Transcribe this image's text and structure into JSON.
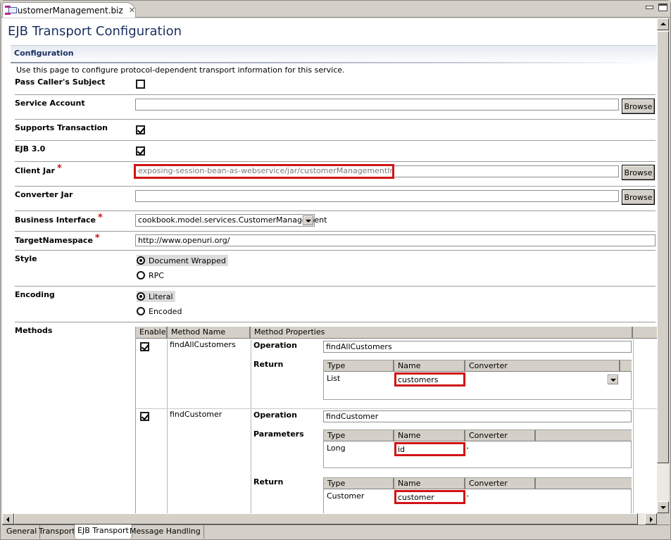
{
  "editor_tab": {
    "title": "CustomerManagement.biz",
    "icon": "biz-file-icon",
    "close_icon": "close-icon"
  },
  "window_controls": {
    "minimize_icon": "minimize-icon",
    "maximize_icon": "maximize-icon"
  },
  "page_title": "EJB Transport Configuration",
  "section": {
    "title": "Configuration",
    "description": "Use this page to configure protocol-dependent transport information for this service."
  },
  "fields": {
    "pass_callers_subject": {
      "label": "Pass Caller's Subject",
      "checked": false
    },
    "service_account": {
      "label": "Service Account",
      "value": "",
      "browse_label": "Browse"
    },
    "supports_transaction": {
      "label": "Supports Transaction",
      "checked": true
    },
    "ejb_30": {
      "label": "EJB 3.0",
      "checked": true
    },
    "client_jar": {
      "label": "Client Jar",
      "required": "*",
      "value": "exposing-session-bean-as-webservice/jar/customerManagementInterface",
      "browse_label": "Browse"
    },
    "converter_jar": {
      "label": "Converter Jar",
      "value": "",
      "browse_label": "Browse"
    },
    "business_interface": {
      "label": "Business Interface",
      "required": "*",
      "selected": "cookbook.model.services.CustomerManagement"
    },
    "target_namespace": {
      "label": "TargetNamespace",
      "required": "*",
      "value": "http://www.openuri.org/"
    },
    "style": {
      "label": "Style",
      "options": [
        "Document Wrapped",
        "RPC"
      ],
      "selected": "Document Wrapped"
    },
    "encoding": {
      "label": "Encoding",
      "options": [
        "Literal",
        "Encoded"
      ],
      "selected": "Literal"
    }
  },
  "methods": {
    "label": "Methods",
    "columns": [
      "Enable",
      "Method Name",
      "Method Properties"
    ],
    "operation_label": "Operation",
    "parameters_label": "Parameters",
    "return_label": "Return",
    "sub_columns": [
      "Type",
      "Name",
      "Converter"
    ],
    "rows": [
      {
        "enabled": true,
        "name": "findAllCustomers",
        "operation": "findAllCustomers",
        "return": {
          "type": "List",
          "name": "customers",
          "converter": ""
        }
      },
      {
        "enabled": true,
        "name": "findCustomer",
        "operation": "findCustomer",
        "parameters": [
          {
            "type": "Long",
            "name": "id",
            "converter": "-"
          }
        ],
        "return": {
          "type": "Customer",
          "name": "customer",
          "converter": "-"
        }
      }
    ]
  },
  "page_tabs": [
    {
      "label": "General",
      "active": false
    },
    {
      "label": "Transport",
      "active": false
    },
    {
      "label": "EJB Transport",
      "active": true
    },
    {
      "label": "Message Handling",
      "active": false
    }
  ]
}
